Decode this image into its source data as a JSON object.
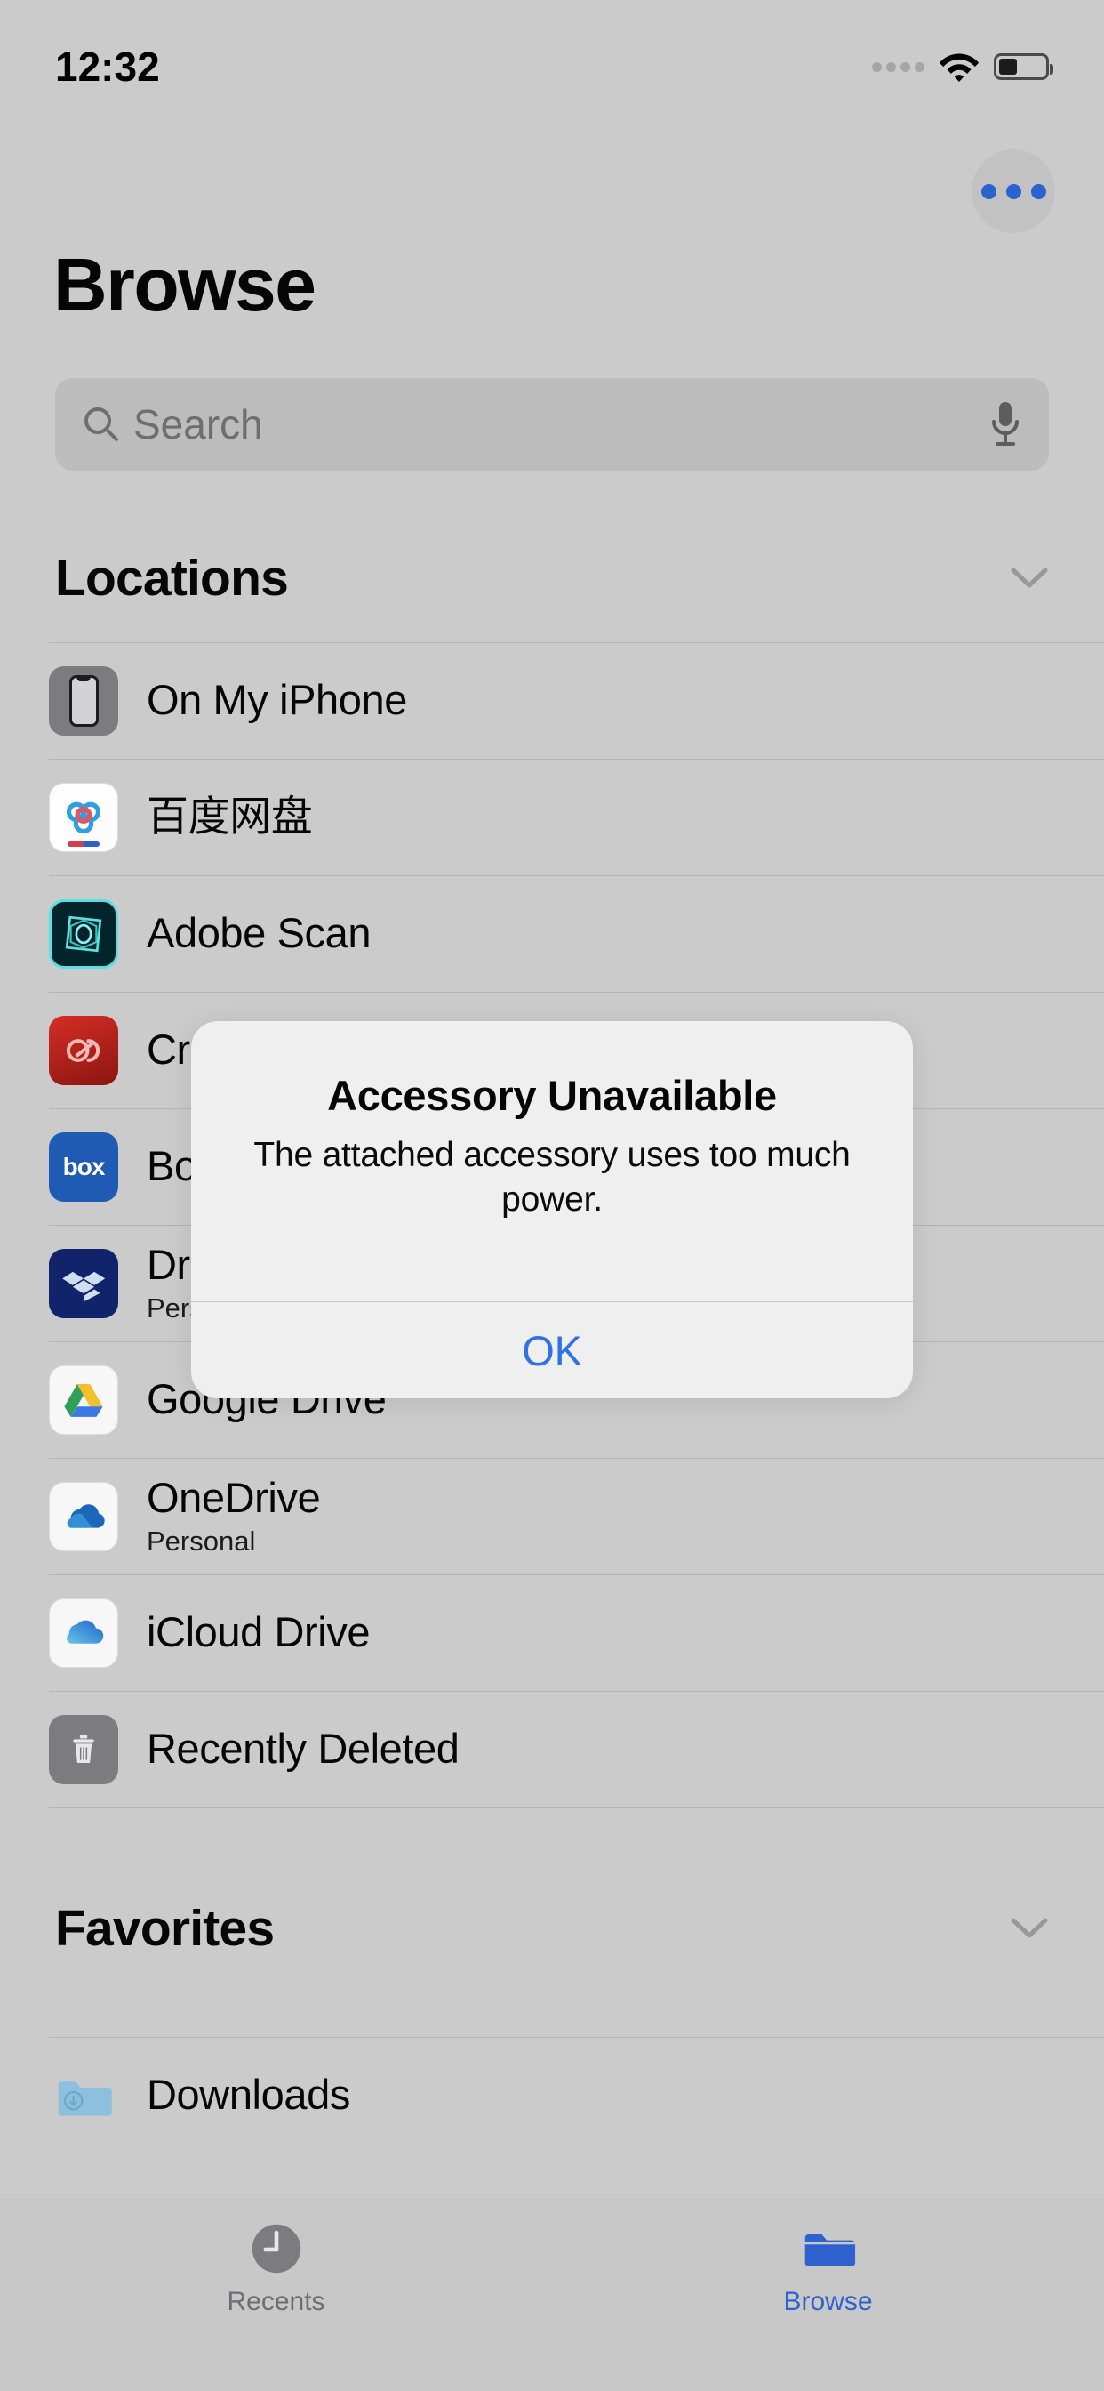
{
  "status_bar": {
    "time": "12:32",
    "signal_icon": "signal-dots-icon",
    "wifi_icon": "wifi-icon",
    "battery_icon": "battery-icon",
    "battery_level_percent": 38
  },
  "nav": {
    "more_button_label": "More",
    "more_button_icon": "ellipsis-circle-icon",
    "accent_color": "#2a62d0"
  },
  "header": {
    "title": "Browse"
  },
  "search": {
    "placeholder": "Search",
    "value": "",
    "search_icon": "search-icon",
    "mic_icon": "microphone-icon"
  },
  "sections": [
    {
      "title": "Locations",
      "collapse_icon": "chevron-down-icon",
      "items": [
        {
          "label": "On My iPhone",
          "subtitle": "",
          "icon": "iphone-icon"
        },
        {
          "label": "百度网盘",
          "subtitle": "",
          "icon": "baidu-netdisk-icon"
        },
        {
          "label": "Adobe Scan",
          "subtitle": "",
          "icon": "adobe-scan-icon"
        },
        {
          "label": "Creative Cloud",
          "subtitle": "",
          "icon": "creative-cloud-icon"
        },
        {
          "label": "Box",
          "subtitle": "",
          "icon": "box-icon"
        },
        {
          "label": "Dropbox",
          "subtitle": "Personal",
          "icon": "dropbox-icon"
        },
        {
          "label": "Google Drive",
          "subtitle": "",
          "icon": "google-drive-icon"
        },
        {
          "label": "OneDrive",
          "subtitle": "Personal",
          "icon": "onedrive-icon"
        },
        {
          "label": "iCloud Drive",
          "subtitle": "",
          "icon": "icloud-drive-icon"
        },
        {
          "label": "Recently Deleted",
          "subtitle": "",
          "icon": "trash-icon"
        }
      ]
    },
    {
      "title": "Favorites",
      "collapse_icon": "chevron-down-icon",
      "items": [
        {
          "label": "Downloads",
          "subtitle": "",
          "icon": "downloads-folder-icon"
        }
      ]
    }
  ],
  "alert": {
    "title": "Accessory Unavailable",
    "message": "The attached accessory uses too much power.",
    "ok_label": "OK",
    "ok_color": "#2f72e8"
  },
  "tab_bar": {
    "tabs": [
      {
        "label": "Recents",
        "icon": "clock-icon",
        "active": false
      },
      {
        "label": "Browse",
        "icon": "folder-icon",
        "active": true
      }
    ],
    "active_color": "#2f62cf",
    "inactive_color": "#6d6d72"
  }
}
